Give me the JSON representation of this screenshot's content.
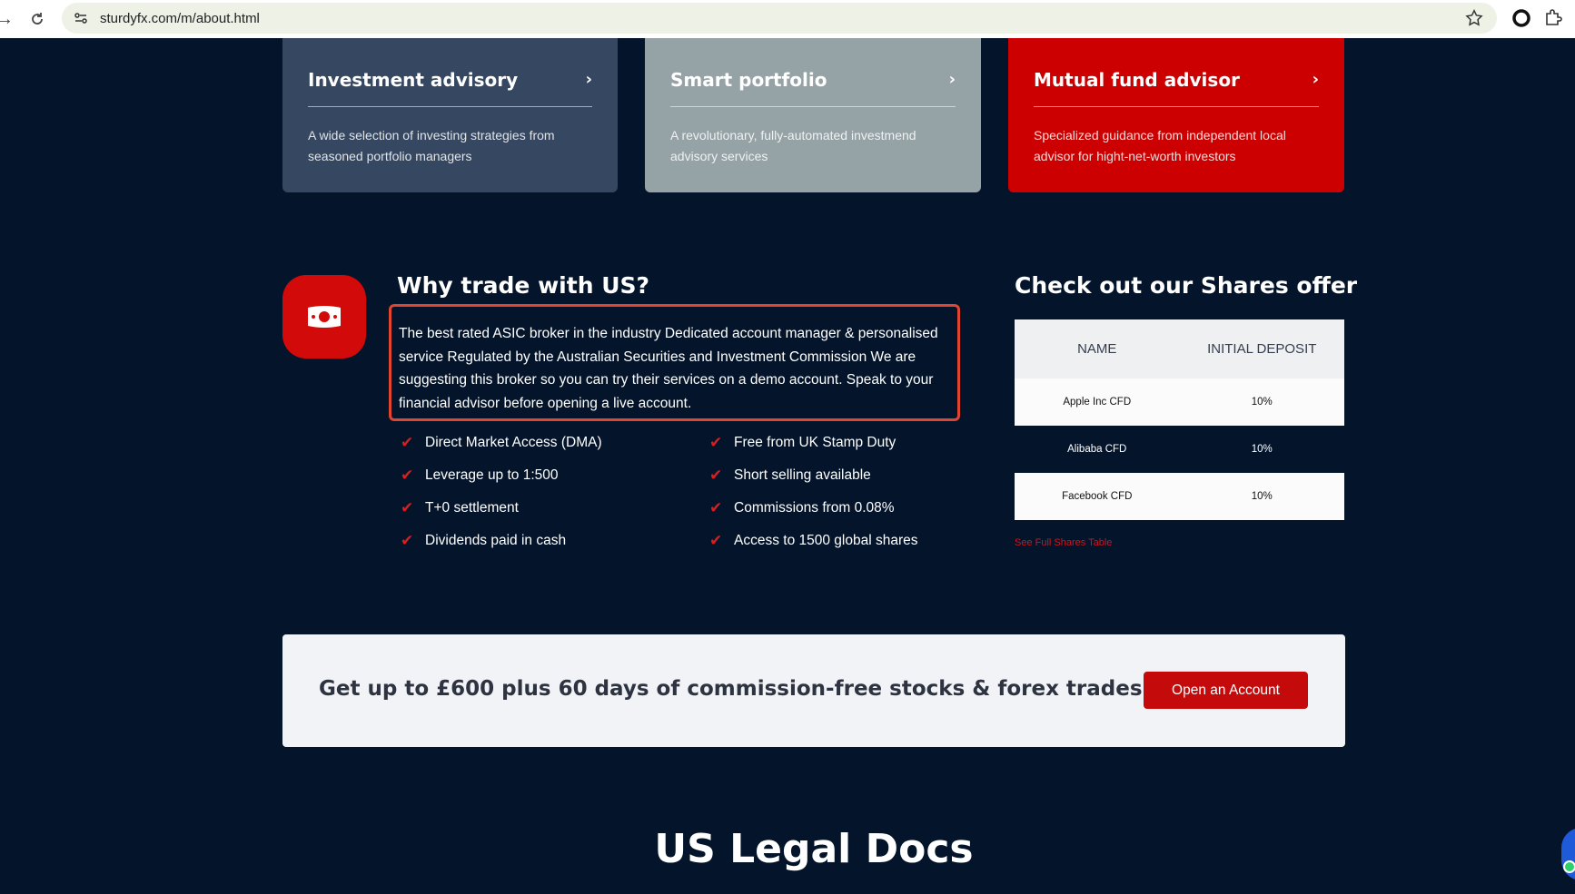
{
  "browser": {
    "url": "sturdyfx.com/m/about.html"
  },
  "cards": [
    {
      "title": "Investment advisory",
      "desc": "A wide selection of investing strategies from seasoned portfolio managers",
      "color": "#354761"
    },
    {
      "title": "Smart portfolio",
      "desc": "A revolutionary, fully-automated investmend advisory services",
      "color": "#95a2a6"
    },
    {
      "title": "Mutual fund advisor",
      "desc": "Specialized guidance from independent local advisor for hight-net-worth investors",
      "color": "#cc0000"
    }
  ],
  "why": {
    "title": "Why trade with US?",
    "text": "The best rated ASIC broker in the industry Dedicated account manager & personalised service Regulated by the Australian Securities and Investment Commission We are suggesting this broker so you can try their services on a demo account. Speak to your financial advisor before opening a live account.",
    "features_left": [
      "Direct Market Access (DMA)",
      "Leverage up to 1:500",
      "T+0 settlement",
      "Dividends paid in cash"
    ],
    "features_right": [
      "Free from UK Stamp Duty",
      "Short selling available",
      "Commissions from 0.08%",
      "Access to 1500 global shares"
    ]
  },
  "shares": {
    "title": "Check out our Shares offer",
    "headers": [
      "NAME",
      "INITIAL DEPOSIT"
    ],
    "rows": [
      [
        "Apple Inc CFD",
        "10%"
      ],
      [
        "Alibaba CFD",
        "10%"
      ],
      [
        "Facebook CFD",
        "10%"
      ]
    ],
    "link": "See Full Shares Table"
  },
  "banner": {
    "text": "Get up to £600 plus 60 days of commission-free stocks & forex trades",
    "button": "Open an Account"
  },
  "legal": {
    "title": "US Legal Docs"
  }
}
